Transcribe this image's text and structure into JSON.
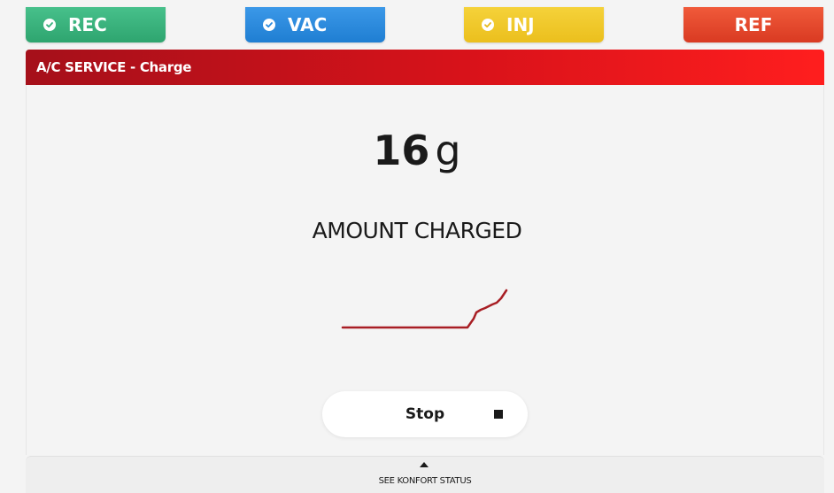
{
  "steps": [
    {
      "label": "REC",
      "done": true,
      "color": "#37b07c"
    },
    {
      "label": "VAC",
      "done": true,
      "color": "#2a8ade"
    },
    {
      "label": "INJ",
      "done": true,
      "color": "#f0c82a"
    },
    {
      "label": "REF",
      "done": false,
      "color": "#e5482e"
    }
  ],
  "header": {
    "title": "A/C SERVICE - Charge",
    "color": "#c8141c"
  },
  "main": {
    "amount_value": "16",
    "amount_unit": "g",
    "amount_label": "AMOUNT CHARGED",
    "graph_line_color": "#a81e24"
  },
  "actions": {
    "stop_label": "Stop",
    "stop_icon": "stop-square-icon"
  },
  "footer": {
    "label": "SEE KONFORT STATUS",
    "icon": "chevron-up-icon"
  }
}
